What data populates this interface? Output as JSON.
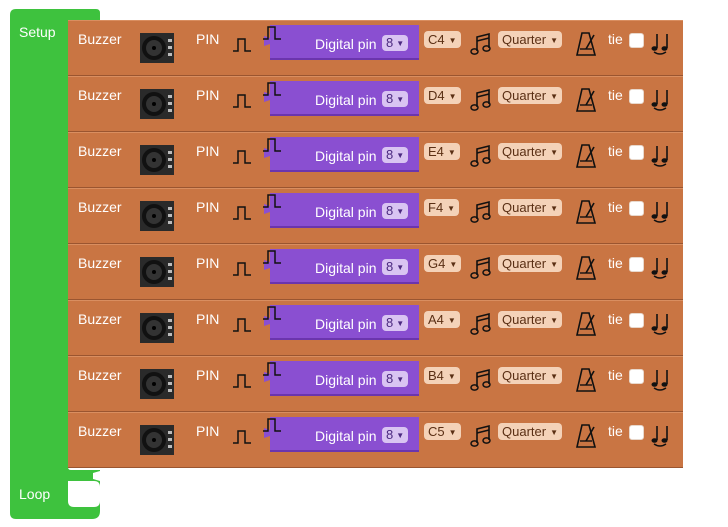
{
  "setup": {
    "label": "Setup"
  },
  "loop": {
    "label": "Loop"
  },
  "colors": {
    "setup_green": "#3ec23e",
    "buzzer_block": "#c97543",
    "pin_block": "#8a4fd1"
  },
  "rows": [
    {
      "buzzer_label": "Buzzer",
      "pin_label": "PIN",
      "pin_text": "Digital pin",
      "pin_value": "8",
      "note": "C4",
      "duration": "Quarter",
      "tie_label": "tie"
    },
    {
      "buzzer_label": "Buzzer",
      "pin_label": "PIN",
      "pin_text": "Digital pin",
      "pin_value": "8",
      "note": "D4",
      "duration": "Quarter",
      "tie_label": "tie"
    },
    {
      "buzzer_label": "Buzzer",
      "pin_label": "PIN",
      "pin_text": "Digital pin",
      "pin_value": "8",
      "note": "E4",
      "duration": "Quarter",
      "tie_label": "tie"
    },
    {
      "buzzer_label": "Buzzer",
      "pin_label": "PIN",
      "pin_text": "Digital pin",
      "pin_value": "8",
      "note": "F4",
      "duration": "Quarter",
      "tie_label": "tie"
    },
    {
      "buzzer_label": "Buzzer",
      "pin_label": "PIN",
      "pin_text": "Digital pin",
      "pin_value": "8",
      "note": "G4",
      "duration": "Quarter",
      "tie_label": "tie"
    },
    {
      "buzzer_label": "Buzzer",
      "pin_label": "PIN",
      "pin_text": "Digital pin",
      "pin_value": "8",
      "note": "A4",
      "duration": "Quarter",
      "tie_label": "tie"
    },
    {
      "buzzer_label": "Buzzer",
      "pin_label": "PIN",
      "pin_text": "Digital pin",
      "pin_value": "8",
      "note": "B4",
      "duration": "Quarter",
      "tie_label": "tie"
    },
    {
      "buzzer_label": "Buzzer",
      "pin_label": "PIN",
      "pin_text": "Digital pin",
      "pin_value": "8",
      "note": "C5",
      "duration": "Quarter",
      "tie_label": "tie"
    }
  ]
}
